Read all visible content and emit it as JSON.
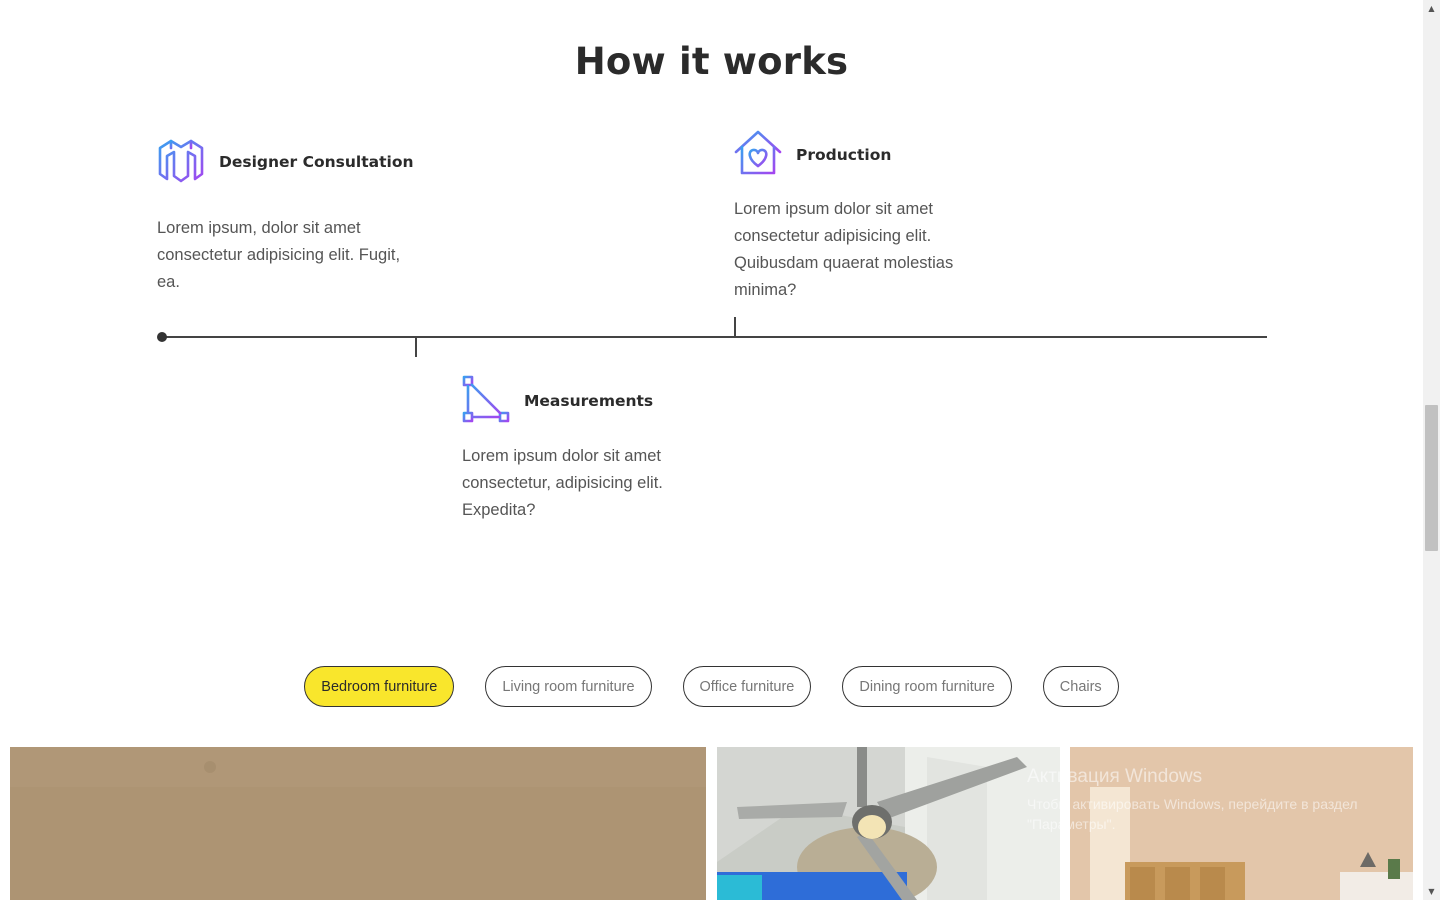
{
  "section": {
    "title": "How it works"
  },
  "steps": [
    {
      "title": "Designer Consultation",
      "icon": "design-blocks-icon",
      "description": "Lorem ipsum, dolor sit amet consectetur adipisicing elit. Fugit, ea."
    },
    {
      "title": "Production",
      "icon": "house-heart-icon",
      "description": "Lorem ipsum dolor sit amet consectetur adipisicing elit. Quibusdam quaerat molestias minima?"
    },
    {
      "title": "Measurements",
      "icon": "ruler-triangle-icon",
      "description": "Lorem ipsum dolor sit amet consectetur, adipisicing elit. Expedita?"
    }
  ],
  "filters": [
    {
      "label": "Bedroom furniture",
      "active": true
    },
    {
      "label": "Living room furniture",
      "active": false
    },
    {
      "label": "Office furniture",
      "active": false
    },
    {
      "label": "Dining room furniture",
      "active": false
    },
    {
      "label": "Chairs",
      "active": false
    }
  ],
  "watermark": {
    "title": "Активация Windows",
    "line1": "Чтобы активировать Windows, перейдите в раздел",
    "line2": "\"Параметры\"."
  },
  "colors": {
    "accent_yellow": "#f9e62c",
    "icon_gradient_start": "#3aa0f0",
    "icon_gradient_end": "#a445f0",
    "text_dark": "#2b2b2b"
  }
}
